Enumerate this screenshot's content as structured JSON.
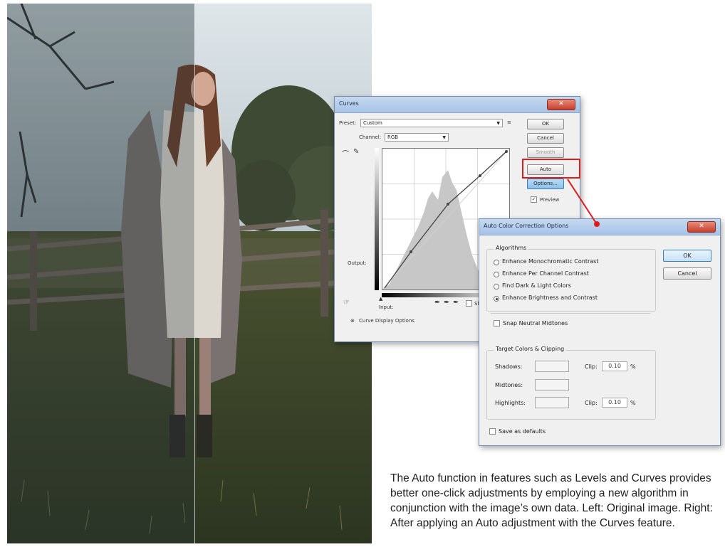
{
  "curves_dialog": {
    "title": "Curves",
    "preset_label": "Preset:",
    "preset_value": "Custom",
    "channel_label": "Channel:",
    "channel_value": "RGB",
    "ok_label": "OK",
    "cancel_label": "Cancel",
    "smooth_label": "Smooth",
    "auto_label": "Auto",
    "options_label": "Options...",
    "preview_label": "Preview",
    "output_label": "Output:",
    "input_label": "Input:",
    "show_clipping_label": "Sho",
    "curve_display_label": "Curve Display Options",
    "preview_checked": true
  },
  "auto_color_dialog": {
    "title": "Auto Color Correction Options",
    "algorithms_title": "Algorithms",
    "algorithms": [
      {
        "label": "Enhance Monochromatic Contrast",
        "selected": false
      },
      {
        "label": "Enhance Per Channel Contrast",
        "selected": false
      },
      {
        "label": "Find Dark & Light Colors",
        "selected": false
      },
      {
        "label": "Enhance Brightness and Contrast",
        "selected": true
      }
    ],
    "snap_label": "Snap Neutral Midtones",
    "target_title": "Target Colors & Clipping",
    "shadows_label": "Shadows:",
    "midtones_label": "Midtones:",
    "highlights_label": "Highlights:",
    "clip_label": "Clip:",
    "shadow_clip": "0.10",
    "highlight_clip": "0.10",
    "percent": "%",
    "save_defaults_label": "Save as defaults",
    "ok_label": "OK",
    "cancel_label": "Cancel"
  },
  "caption": {
    "text": "The Auto function in features such as Levels and Curves provides better one-click adjustments by employing a new algorithm in conjunction with the image’s own data. Left: Original image. Right: After applying an Auto adjustment with the Curves feature."
  },
  "colors": {
    "highlight_red": "#e01b1b",
    "title_blue": "#a7c3e6"
  }
}
